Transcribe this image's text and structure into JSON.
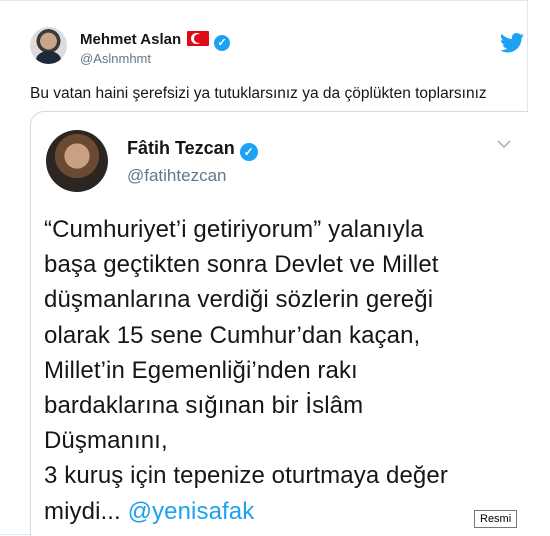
{
  "outer_tweet": {
    "name": "Mehmet Aslan",
    "handle": "@Aslnmhmt",
    "text": "Bu vatan haini şerefsizi ya tutuklarsınız ya da çöplükten toplarsınız"
  },
  "quoted_tweet": {
    "name": "Fâtih Tezcan",
    "handle": "@fatihtezcan",
    "lines": [
      "“Cumhuriyet’i getiriyorum” yalanıyla",
      "başa geçtikten sonra Devlet ve Millet",
      "düşmanlarına verdiği sözlerin gereği",
      "olarak 15 sene Cumhur’dan kaçan,",
      "Millet’in Egemenliği’nden rakı",
      "bardaklarına sığınan bir İslâm",
      "Düşmanını,",
      "3 kuruş için tepenize oturtmaya değer"
    ],
    "last_line_prefix": "miydi... ",
    "mention": "@yenisafak"
  },
  "tooltip": "Resmi",
  "icons": {
    "flag": "turkey-flag-icon",
    "verified": "verified-badge-icon",
    "brand": "twitter-bird-icon",
    "caret": "chevron-down-icon"
  },
  "colors": {
    "brand_blue": "#1da1f2",
    "flag_red": "#e30a17",
    "muted_text": "#657786"
  }
}
